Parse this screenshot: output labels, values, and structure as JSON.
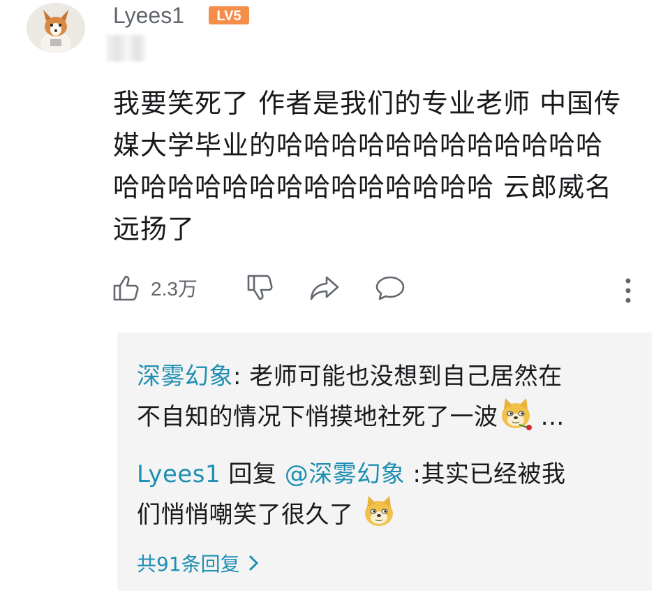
{
  "comment": {
    "username": "Lyees1",
    "level_badge": "LV5",
    "text": "我要笑死了 作者是我们的专业老师 中国传\n媒大学毕业的哈哈哈哈哈哈哈哈哈哈哈哈\n哈哈哈哈哈哈哈哈哈哈哈哈哈哈 云郎威名\n远扬了",
    "like_count": "2.3万"
  },
  "replies": [
    {
      "user": "深雾幻象",
      "sep": ": ",
      "text": "老师可能也没想到自己居然在\n不自知的情况下悄摸地社死了一波",
      "trail": " ..."
    },
    {
      "user": "Lyees1",
      "reply_word": " 回复 ",
      "mention": "@深雾幻象",
      "text": " :其实已经被我\n们悄悄嘲笑了很久了"
    }
  ],
  "more_replies_label": "共91条回复",
  "colors": {
    "link": "#1d8fb3",
    "badge": "#f58d4b",
    "text": "#18191c",
    "muted": "#61666d",
    "reply_bg": "#f4f4f4"
  },
  "icons": [
    "like-icon",
    "dislike-icon",
    "share-icon",
    "reply-icon",
    "more-icon",
    "chevron-right-icon",
    "doge-emoji-icon"
  ]
}
